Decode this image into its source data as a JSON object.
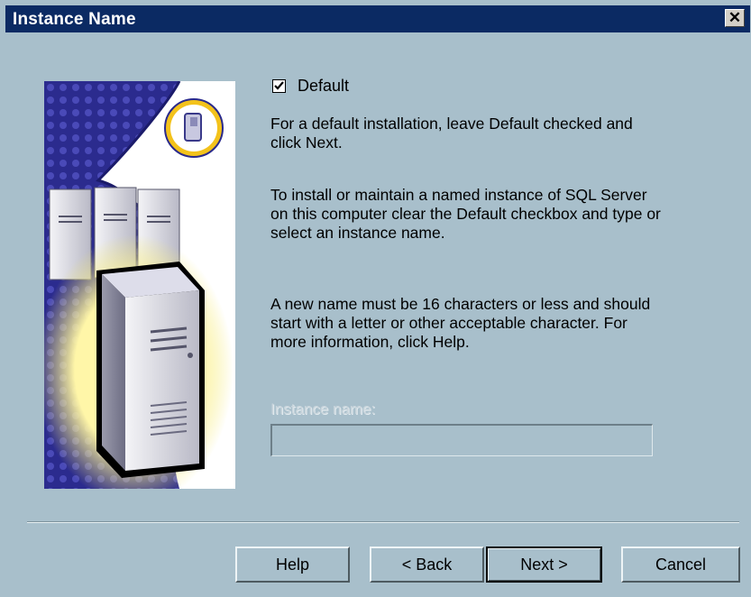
{
  "window": {
    "title": "Instance Name",
    "close_label": "✕"
  },
  "default_checkbox": {
    "label": "Default",
    "checked": true
  },
  "paragraphs": [
    "For a default installation, leave Default checked and click Next.",
    "To install or maintain a named instance of SQL Server on this computer clear the Default checkbox and type or select an instance name.",
    "A new name must be 16 characters or less and should start with a letter or other acceptable character.  For more information, click Help."
  ],
  "instance_name": {
    "label": "Instance name:",
    "value": "",
    "enabled": false
  },
  "buttons": {
    "help": "Help",
    "back": "< Back",
    "next": "Next >",
    "cancel": "Cancel"
  },
  "icons": {
    "illustration": "server-tower-illustration",
    "badge": "server-badge-icon",
    "check": "checkmark-icon"
  },
  "colors": {
    "titlebar": "#0b2a63",
    "dialog_bg": "#a8bfcb",
    "art_navy": "#2a2a8c",
    "glow_yellow": "#f3e86a"
  }
}
